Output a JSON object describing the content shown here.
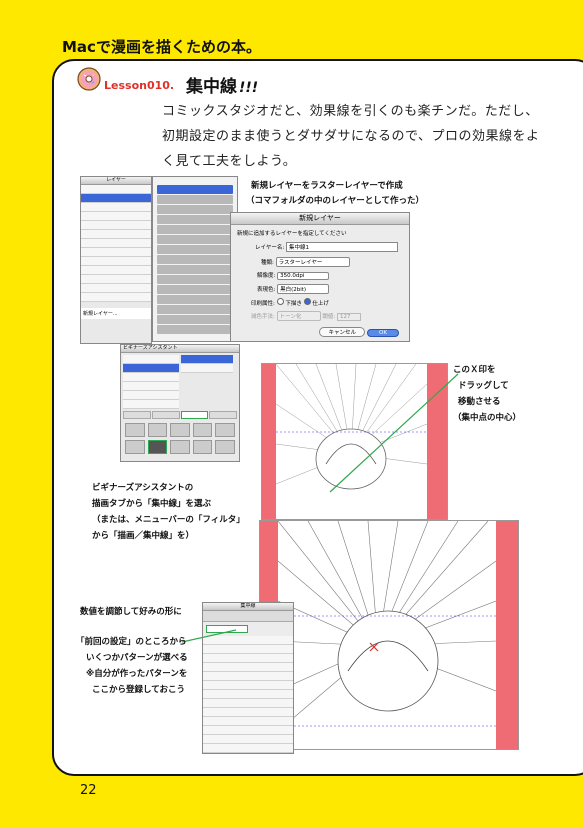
{
  "header": {
    "title": "Macで漫画を描くための本。"
  },
  "lesson": {
    "label": "Lesson010.",
    "title": "集中線",
    "title_suffix": "!!!"
  },
  "intro": {
    "line1": "コミックスタジオだと、効果線を引くのも楽チンだ。ただし、",
    "line2": "初期設定のまま使うとダサダサになるので、プロの効果線をよ",
    "line3": "く見て工夫をしよう。"
  },
  "captions": {
    "new_layer_1": "新規レイヤーをラスターレイヤーで作成",
    "new_layer_2": "（コマフォルダの中のレイヤーとして作った）",
    "xmark_1": "このＸ印を",
    "xmark_2": "ドラッグして",
    "xmark_3": "移動させる",
    "xmark_4": "（集中点の中心）",
    "assistant_1": "ビギナーズアシスタントの",
    "assistant_2": "描画タブから「集中線」を選ぶ",
    "assistant_3": "（または、メニューバーの「フィルタ」",
    "assistant_4": "から「描画／集中線」を）",
    "adjust_1": "数値を調節して好みの形に",
    "adjust_2": "「前回の設定」のところから",
    "adjust_3": "いくつかパターンが選べる",
    "adjust_4": "※自分が作ったパターンを",
    "adjust_5": "ここから登録しておこう"
  },
  "dialog": {
    "title": "新規レイヤー",
    "prompt": "新規に追加するレイヤーを指定してください",
    "name_label": "レイヤー名:",
    "name_value": "集中線1",
    "type_label": "種類:",
    "type_value": "ラスターレイヤー",
    "resolution_label": "解像度:",
    "resolution_value": "350.0dpi",
    "color_label": "表現色:",
    "color_value": "黒白(2bit)",
    "print_label": "印刷属性:",
    "print_draft": "下描き",
    "print_final": "仕上げ",
    "reduce_label": "減色手法:",
    "reduce_value": "トーン化",
    "threshold_label": "閾値:",
    "threshold_value": "127",
    "cancel": "キャンセル",
    "ok": "OK"
  },
  "screens": {
    "layer_panel_title": "レイヤー",
    "assistant_title": "ビギナーズアシスタント",
    "filter_title": "集中線",
    "menu_new_layer": "新規レイヤー...",
    "menu_new_layer_bottom": "新規レイヤー..."
  },
  "page_number": "22",
  "colors": {
    "background": "#ffe800",
    "lesson_red": "#e0302a",
    "bleed_red": "#f06c74",
    "accent_green": "#2fa84f",
    "selection_blue": "#3a66d8"
  }
}
